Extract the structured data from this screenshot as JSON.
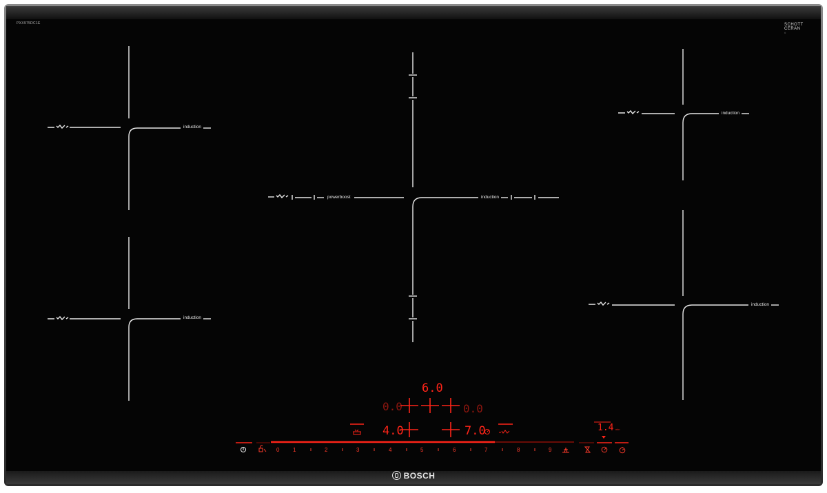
{
  "model_label": "PXX975DC1E",
  "glass_brand": {
    "line1": "SCHOTT",
    "line2": "CERAN",
    "line3": "®"
  },
  "brand": "BOSCH",
  "zones": {
    "top_left_label": "induction",
    "bottom_left_label": "induction",
    "center_left_label": "powerboost",
    "center_right_label": "induction",
    "top_right_label": "induction",
    "bottom_right_label": "induction"
  },
  "display": {
    "top_value": "6.0",
    "row2_left": "0.0",
    "row2_right": "0.0",
    "row3_left": "4.0",
    "row3_right": "7.0",
    "timer_value": "1.4",
    "timer_unit": "min"
  },
  "control_bar": {
    "scale": [
      "0",
      "1",
      "2",
      "3",
      "4",
      "5",
      "6",
      "7",
      "8",
      "9"
    ],
    "power_icon": "power-icon",
    "child_lock_icon": "child-lock-icon",
    "boost_icon": "boost-icon",
    "hourglass_icon": "hourglass-icon",
    "timer_icon": "timer-icon",
    "stopwatch_icon": "stopwatch-icon"
  },
  "colors": {
    "glass": "#050505",
    "display_red": "#ff2418",
    "lines": "#e8e8e8"
  }
}
